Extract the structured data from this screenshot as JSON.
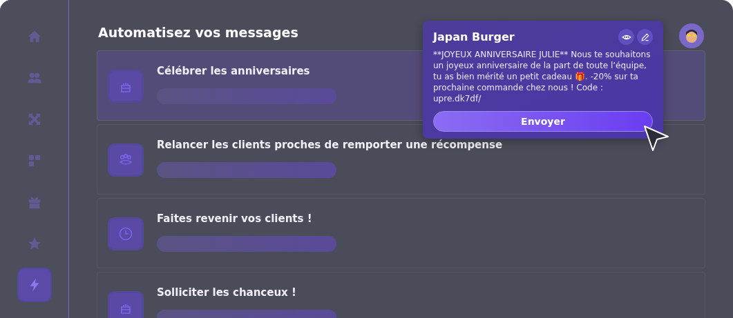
{
  "sidebar": {
    "items": [
      {
        "selected": false
      },
      {
        "selected": false
      },
      {
        "selected": false
      },
      {
        "selected": false
      },
      {
        "selected": false
      },
      {
        "selected": false
      },
      {
        "selected": true
      }
    ]
  },
  "header": {
    "title": "Automatisez vos messages"
  },
  "cards": [
    {
      "kind": "cake",
      "title": "Célébrer les anniversaires",
      "selected": true
    },
    {
      "kind": "group",
      "title": "Relancer les clients proches de remporter une récompense",
      "selected": false
    },
    {
      "kind": "clock",
      "title": "Faites revenir vos clients !",
      "selected": false
    },
    {
      "kind": "cake",
      "title": "Solliciter les chanceux !",
      "selected": false
    }
  ],
  "popup": {
    "title": "Japan Burger",
    "message": "**JOYEUX ANNIVERSAIRE JULIE** Nous te souhaitons un joyeux anniversaire de la part de toute l’équipe, tu as bien mérité un petit cadeau 🎁. -20% sur ta prochaine commande chez nous ! Code : upre.dk7df/",
    "button": "Envoyer"
  }
}
